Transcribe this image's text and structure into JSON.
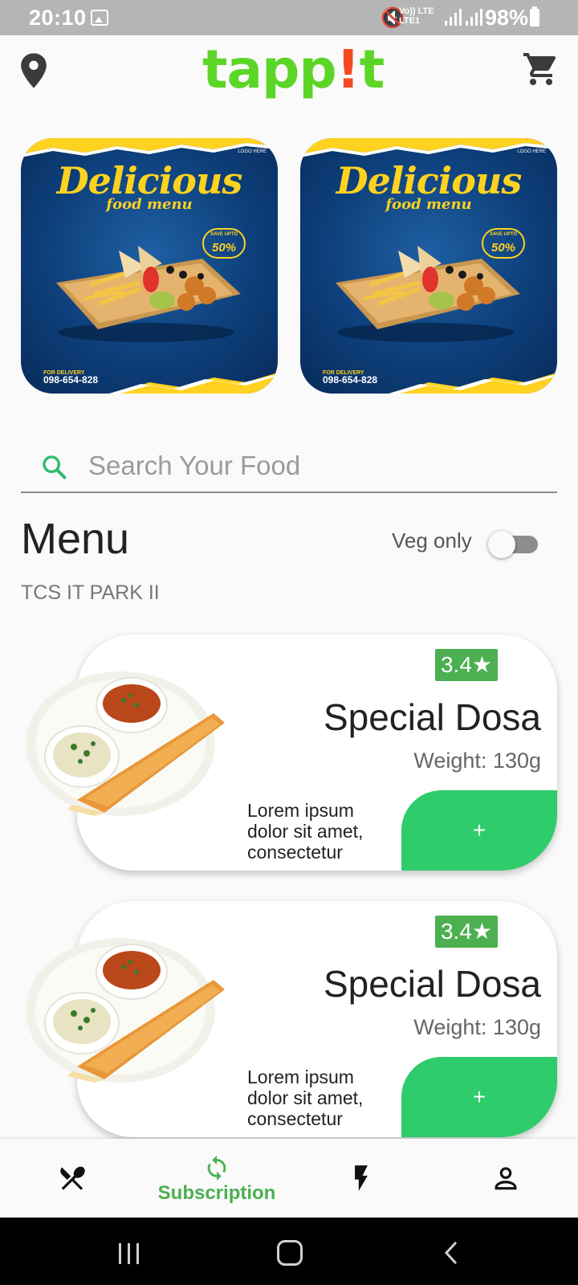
{
  "status_bar": {
    "time": "20:10",
    "network_top": "Vo)) LTE",
    "network_bottom": "LTE1",
    "battery": "98%"
  },
  "header": {
    "logo_prefix": "tapp",
    "logo_accent": "!",
    "logo_suffix": "t",
    "location_icon": "location-pin-icon",
    "cart_icon": "shopping-cart-icon"
  },
  "banners": [
    {
      "title": "Delicious",
      "subtitle": "food menu",
      "badge_small": "SAVE UPTO",
      "badge": "50%",
      "logo": "LOGO HERE",
      "delivery_label": "FOR DELIVERY",
      "phone": "098-654-828"
    },
    {
      "title": "Delicious",
      "subtitle": "food menu",
      "badge_small": "SAVE UPTO",
      "badge": "50%",
      "logo": "LOGO HERE",
      "delivery_label": "FOR DELIVERY",
      "phone": "098-654-828"
    }
  ],
  "search": {
    "placeholder": "Search Your Food",
    "value": ""
  },
  "menu": {
    "title": "Menu",
    "location": "TCS IT PARK II",
    "veg_label": "Veg only",
    "veg_enabled": false
  },
  "products": [
    {
      "rating": "3.4★",
      "name": "Special Dosa",
      "weight": "Weight: 130g",
      "description": "Lorem ipsum dolor sit amet, consectetur",
      "add_label": "+"
    },
    {
      "rating": "3.4★",
      "name": "Special Dosa",
      "weight": "Weight: 130g",
      "description": "Lorem ipsum dolor sit amet, consectetur",
      "add_label": "+"
    }
  ],
  "bottom_nav": {
    "items": [
      {
        "icon": "fork-knife-icon",
        "label": ""
      },
      {
        "icon": "refresh-icon",
        "label": "Subscription",
        "active": true
      },
      {
        "icon": "lightning-icon",
        "label": ""
      },
      {
        "icon": "person-icon",
        "label": ""
      }
    ]
  },
  "colors": {
    "brand_green": "#5cd626",
    "brand_accent": "#f44a24",
    "add_button": "#2ecc6a",
    "rating_badge": "#4caf50",
    "active_nav": "#4caf50"
  }
}
